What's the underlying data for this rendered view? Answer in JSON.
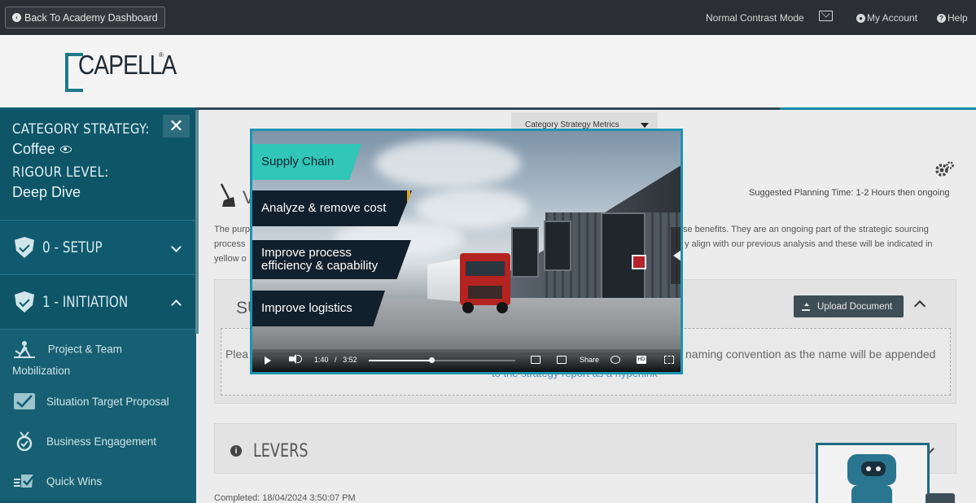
{
  "topbar": {
    "back_label": "Back To Academy Dashboard",
    "contrast_label": "Normal Contrast Mode",
    "account_label": "My Account",
    "help_label": "Help"
  },
  "logo": {
    "text": "CAPELLA",
    "mark": "®"
  },
  "sidebar": {
    "strategy_heading": "CATEGORY STRATEGY:",
    "strategy_value": "Coffee",
    "rigour_heading": "RIGOUR LEVEL:",
    "rigour_value": "Deep Dive",
    "sections": [
      {
        "label": "0 - SETUP",
        "state": "collapsed"
      },
      {
        "label": "1 - INITIATION",
        "state": "expanded"
      }
    ],
    "items": [
      {
        "label": "Project & Team",
        "label2": "Mobilization",
        "icon": "team-icon"
      },
      {
        "label": "Situation Target Proposal",
        "icon": "target-check-icon"
      },
      {
        "label": "Business Engagement",
        "icon": "medal-icon"
      },
      {
        "label": "Quick Wins",
        "icon": "quick-check-icon"
      }
    ]
  },
  "main": {
    "metrics_tab": "Category Strategy Metrics",
    "planning_time": "Suggested Planning Time: 1-2 Hours then ongoing",
    "title_fragment": "V",
    "para": {
      "l1": "The purp",
      "l2": "process",
      "l3": "yellow o",
      "r1": "se benefits. They are an ongoing part of the strategic sourcing",
      "r2": "y align with our previous analysis and these will be indicated in"
    },
    "panel_title_fragment": "SU",
    "upload_label": "Upload Document",
    "drop_left": "Plea",
    "drop_right": "naming convention as the name will be appended",
    "drop_link": "to the strategy report as a hyperlink",
    "levers_label": "LEVERS",
    "completed": "Completed: 18/04/2024 3:50:07 PM"
  },
  "video": {
    "tags": [
      "Supply Chain",
      "Analyze & remove cost",
      "Improve process efficiency & capability",
      "Improve logistics"
    ],
    "time_current": "1:40",
    "time_sep": "/",
    "time_total": "3:52",
    "progress": 0.43,
    "share_label": "Share",
    "hd_label": "HD",
    "colors": {
      "tag_teal": "#31c6b8",
      "tag_dark": "#12202d",
      "stripe": "#e0a21a",
      "border": "#1c93b3"
    }
  }
}
